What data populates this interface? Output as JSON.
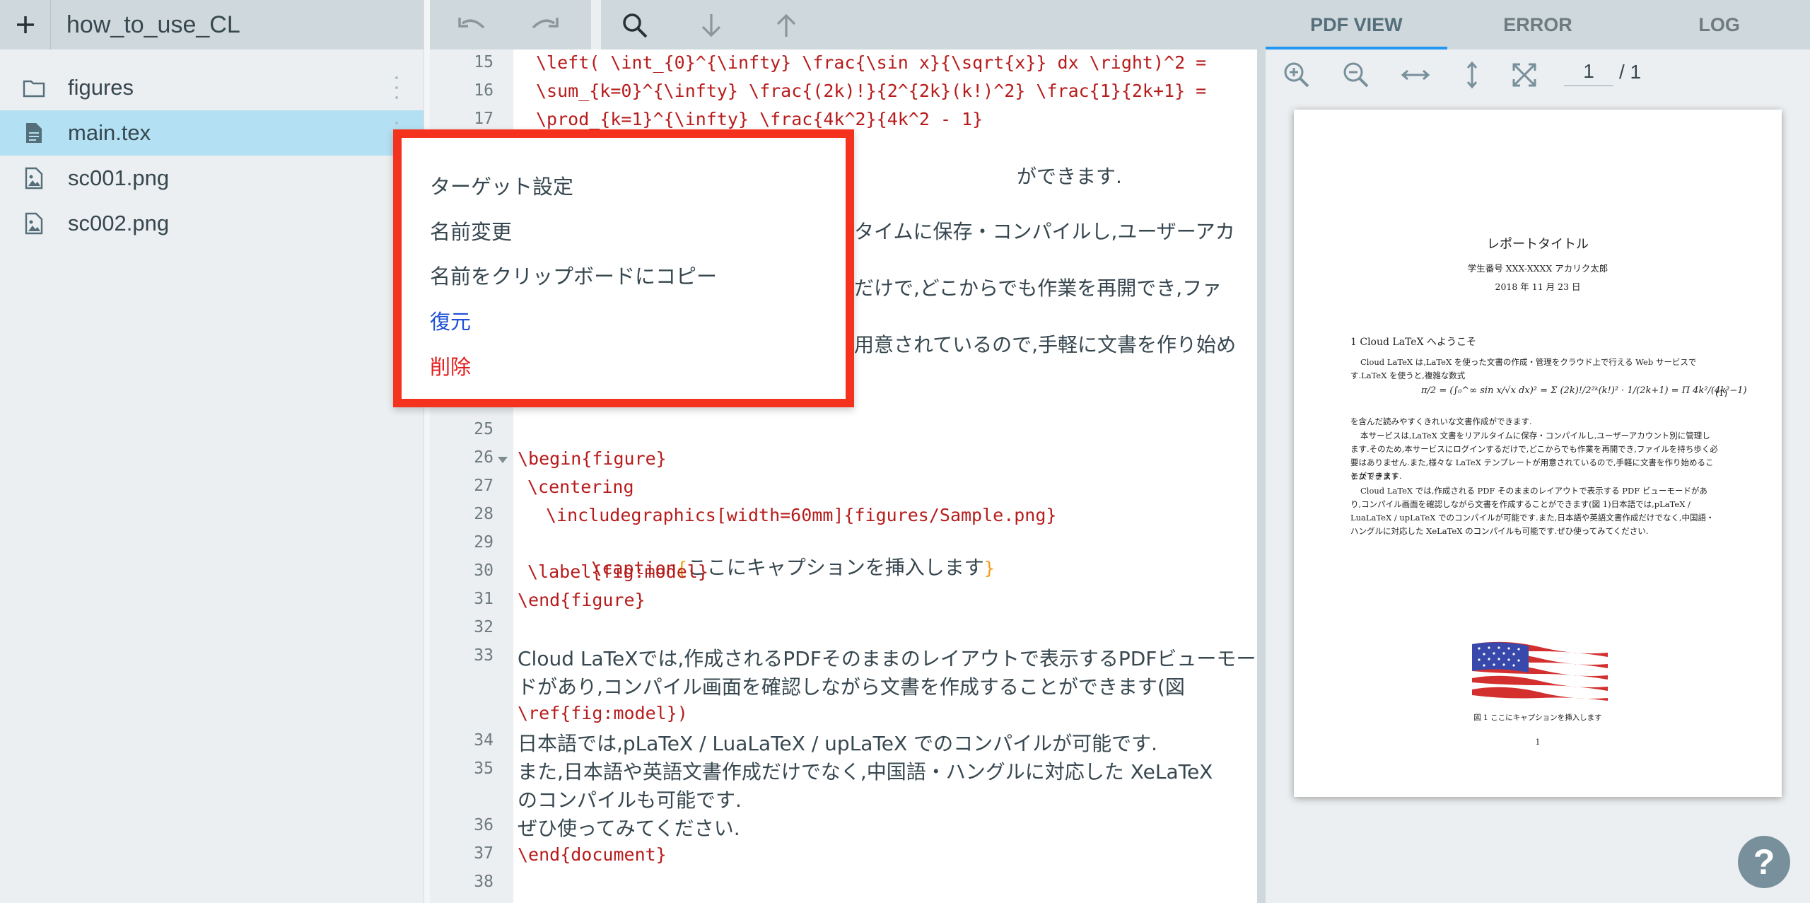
{
  "sidebar": {
    "add_icon": "plus-icon",
    "project_title": "how_to_use_CL",
    "files": [
      {
        "name": "figures",
        "icon": "folder-icon"
      },
      {
        "name": "main.tex",
        "icon": "document-icon",
        "active": true
      },
      {
        "name": "sc001.png",
        "icon": "image-icon"
      },
      {
        "name": "sc002.png",
        "icon": "image-icon"
      }
    ]
  },
  "editor": {
    "toolbar": {
      "undo": "undo-icon",
      "redo": "redo-icon",
      "search": "search-icon",
      "next": "arrow-down-icon",
      "prev": "arrow-up-icon"
    },
    "line_numbers": [
      "15",
      "16",
      "17",
      "25",
      "26",
      "27",
      "28",
      "29",
      "30",
      "31",
      "32",
      "33",
      "34",
      "35",
      "36",
      "37",
      "38"
    ],
    "lines": {
      "l15": "\\left( \\int_{0}^{\\infty} \\frac{\\sin x}{\\sqrt{x}} dx \\right)^2 =",
      "l16": "\\sum_{k=0}^{\\infty} \\frac{(2k)!}{2^{2k}(k!)^2} \\frac{1}{2k+1} =",
      "l17": "\\prod_{k=1}^{\\infty} \\frac{4k^2}{4k^2 - 1}",
      "hidden_a": "ができます.",
      "hidden_b": "タイムに保存・コンパイルし,ユーザーアカ",
      "hidden_c": "だけで,どこからでも作業を再開でき,ファ",
      "hidden_d": "用意されているので,手軽に文書を作り始め",
      "l26": "\\begin{figure}",
      "l27": "\\centering",
      "l28": "\\includegraphics[width=60mm]{figures/Sample.png}",
      "l29_cmd": "\\caption",
      "l29_text": "ここにキャプションを挿入します",
      "l30": "\\label{fig:model}",
      "l31": "\\end{figure}",
      "l33_a": "Cloud LaTeXでは,作成されるPDFそのままのレイアウトで表示するPDFビューモー",
      "l33_b": "ドがあり,コンパイル画面を確認しながら文書を作成することができます(図",
      "l33_c": "\\ref{fig:model})",
      "l34": "日本語では,pLaTeX / LuaLaTeX / upLaTeX でのコンパイルが可能です.",
      "l35_a": "また,日本語や英語文書作成だけでなく,中国語・ハングルに対応した XeLaTeX",
      "l35_b": "のコンパイルも可能です.",
      "l36": "ぜひ使ってみてください.",
      "l37": "\\end{document}"
    }
  },
  "context_menu": {
    "items": [
      {
        "label": "ターゲット設定",
        "color": "#37474f"
      },
      {
        "label": "名前変更",
        "color": "#37474f"
      },
      {
        "label": "名前をクリップボードにコピー",
        "color": "#37474f"
      },
      {
        "label": "復元",
        "color": "#1e4fd6"
      },
      {
        "label": "削除",
        "color": "#e31b1b"
      }
    ]
  },
  "right_panel": {
    "tabs": [
      "PDF VIEW",
      "ERROR",
      "LOG"
    ],
    "active_tab": "PDF VIEW",
    "pdf_toolbar": {
      "zoom_in": "zoom-in-icon",
      "zoom_out": "zoom-out-icon",
      "fit_width": "fit-width-icon",
      "fit_height": "fit-height-icon",
      "fullscreen": "fullscreen-icon",
      "page_current": "1",
      "page_total": "/ 1"
    },
    "pdf": {
      "title": "レポートタイトル",
      "author": "学生番号 XXX-XXXX アカリク太郎",
      "date": "2018 年 11 月 23 日",
      "section": "1   Cloud LaTeX へようこそ",
      "para1": "Cloud LaTeX は,LaTeX を使った文書の作成・管理をクラウド上で行える Web サービスです.LaTeX を使うと,複雑な数式",
      "equation_number": "(1)",
      "para2": "を含んだ読みやすくきれいな文書作成ができます.",
      "para3": "本サービスは,LaTeX 文書をリアルタイムに保存・コンパイルし,ユーザーアカウント別に管理します.そのため,本サービスにログインするだけで,どこからでも作業を再開でき,ファイルを持ち歩く必要はありません.また,様々な LaTeX テンプレートが用意されているので,手軽に文書を作り始めることができます.",
      "para4": "テストテスト",
      "para5": "Cloud LaTeX では,作成される PDF そのままのレイアウトで表示する PDF ビューモードがあり,コンパイル画面を確認しながら文書を作成することができます(図 1)日本語では,pLaTeX / LuaLaTeX / upLaTeX でのコンパイルが可能です.また,日本語や英語文書作成だけでなく,中国語・ハングルに対応した XeLaTeX のコンパイルも可能です.ぜひ使ってみてください.",
      "figure_caption": "図 1   ここにキャプションを挿入します",
      "page_number": "1"
    },
    "help_icon": "help-icon",
    "help_label": "?"
  }
}
